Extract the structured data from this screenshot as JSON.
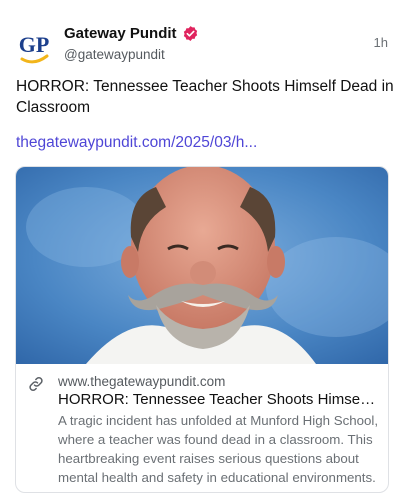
{
  "post": {
    "author": {
      "display_name": "Gateway Pundit",
      "handle": "@gatewaypundit",
      "avatar_text": "GP",
      "verified_icon": "verified-badge-icon",
      "verified_color": "#e0245e"
    },
    "time": "1h",
    "text": "HORROR: Tennessee Teacher Shoots Himself Dead in Classroom",
    "link": "thegatewaypundit.com/2025/03/h...",
    "link_color": "#4f46d6"
  },
  "card": {
    "image_alt": "photo of a smiling man with gray hair and a large handlebar mustache",
    "link_icon": "link-icon",
    "domain": "www.thegatewaypundit.com",
    "title": "HORROR: Tennessee Teacher Shoots Himself Dead in Classroom",
    "description": "A tragic incident has unfolded at Munford High School, where a teacher was found dead in a classroom. This heartbreaking event raises serious questions about mental health and safety in educational environments."
  }
}
